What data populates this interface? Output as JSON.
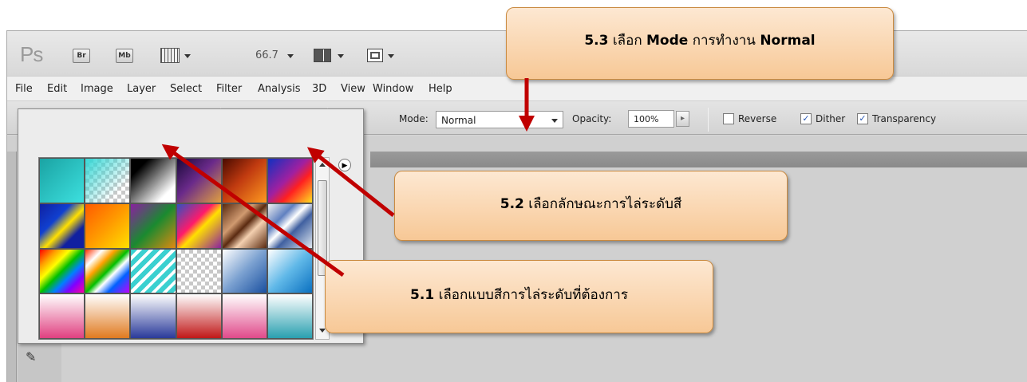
{
  "app_bar": {
    "logo": "Ps",
    "bridge_button": "Br",
    "minibridge_button": "Mb",
    "zoom_value": "66.7"
  },
  "menu": [
    "File",
    "Edit",
    "Image",
    "Layer",
    "Select",
    "Filter",
    "Analysis",
    "3D",
    "View",
    "Window",
    "Help"
  ],
  "options": {
    "mode_label": "Mode:",
    "mode_value": "Normal",
    "opacity_label": "Opacity:",
    "opacity_value": "100%",
    "reverse_label": "Reverse",
    "reverse_checked": false,
    "dither_label": "Dither",
    "dither_checked": true,
    "transparency_label": "Transparency",
    "transparency_checked": true
  },
  "callouts": {
    "c53_num": "5.3",
    "c53_a": "เลือก",
    "c53_mode": "Mode",
    "c53_b": "การทำงาน",
    "c53_normal": "Normal",
    "c52_num": "5.2",
    "c52_text": "เลือกลักษณะการไล่ระดับสี",
    "c51_num": "5.1",
    "c51_text": "เลือกแบบสีการไล่ระดับที่ต้องการ"
  },
  "colors": {
    "callout_fill": "#f7c896",
    "arrow": "#c00000"
  }
}
